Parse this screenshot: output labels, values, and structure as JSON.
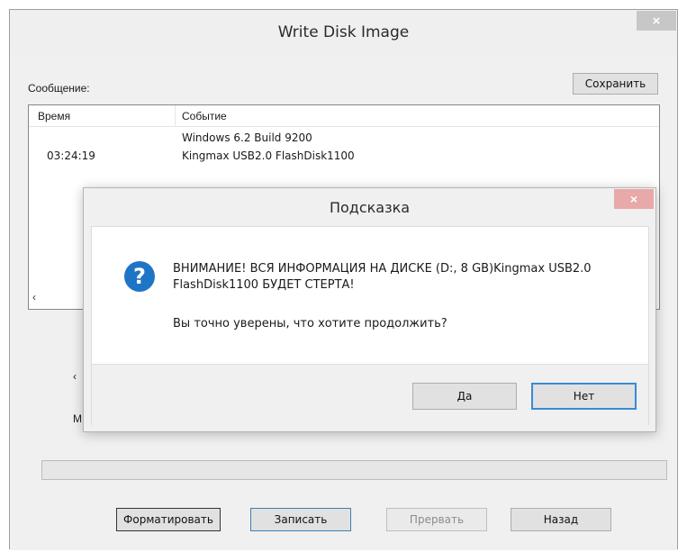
{
  "window": {
    "title": "Write Disk Image",
    "close_glyph": "×"
  },
  "messages": {
    "label": "Сообщение:",
    "save_label": "Сохранить",
    "columns": [
      "Время",
      "Событие"
    ],
    "rows": [
      {
        "time": "",
        "event": "Windows 6.2 Build 9200"
      },
      {
        "time": "03:24:19",
        "event": "Kingmax USB2.0 FlashDisk1100"
      }
    ]
  },
  "obscured": {
    "frag1": "‹",
    "frag2": "M"
  },
  "progress": {
    "value": 0
  },
  "actions": {
    "format_label": "Форматировать",
    "write_label": "Записать",
    "abort_label": "Прервать",
    "back_label": "Назад"
  },
  "dialog": {
    "title": "Подсказка",
    "close_glyph": "×",
    "icon": "question-icon",
    "icon_glyph": "?",
    "warning": "ВНИМАНИЕ! ВСЯ ИНФОРМАЦИЯ НА ДИСКЕ (D:, 8 GB)Kingmax USB2.0 FlashDisk1100 БУДЕТ СТЕРТА!",
    "question": "Вы точно уверены, что хотите продолжить?",
    "yes_label": "Да",
    "no_label": "Нет"
  },
  "colors": {
    "accent": "#1f75c5",
    "focus_border": "#3a8ad6",
    "dialog_close": "#e8a9a9"
  }
}
